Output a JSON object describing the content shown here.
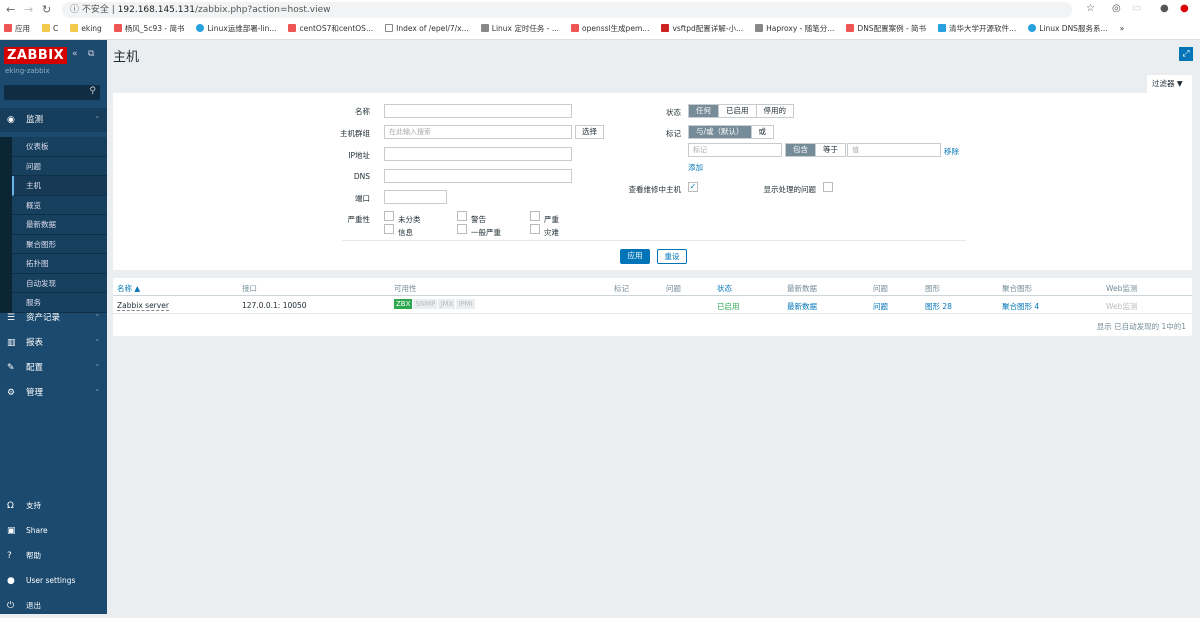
{
  "browser": {
    "security": "不安全",
    "url_host": "192.168.145.131",
    "url_path": "/zabbix.php?action=host.view",
    "bookmarks": [
      "应用",
      "C",
      "eking",
      "杨风_5c93 - 简书",
      "Linux运维部署-lin...",
      "centOS7和centOS...",
      "Index of /epel/7/x...",
      "Linux 定时任务 - ...",
      "openssl生成pem...",
      "vsftpd配置详解-小...",
      "Haproxy - 随笔分...",
      "DNS配置案例 - 简书",
      "清华大学开源软件...",
      "Linux DNS服务系..."
    ],
    "more": "»"
  },
  "sidebar": {
    "logo": "ZABBIX",
    "server": "eking-zabbix",
    "monitoring": "监测",
    "items": [
      "仪表板",
      "问题",
      "主机",
      "概览",
      "最新数据",
      "聚合图形",
      "拓扑图",
      "自动发现",
      "服务"
    ],
    "active": "主机",
    "groups": [
      "资产记录",
      "报表",
      "配置",
      "管理"
    ],
    "bottom": [
      "支持",
      "Share",
      "帮助",
      "User settings",
      "退出"
    ]
  },
  "page": {
    "title": "主机",
    "filter_tab": "过滤器"
  },
  "filter": {
    "name_label": "名称",
    "hostgroup_label": "主机群组",
    "hostgroup_placeholder": "在此输入搜索",
    "select": "选择",
    "ip_label": "IP地址",
    "dns_label": "DNS",
    "port_label": "端口",
    "severity_label": "严重性",
    "severities": [
      "未分类",
      "警告",
      "严重",
      "信息",
      "一般严重",
      "灾难"
    ],
    "status_label": "状态",
    "status_options": [
      "任何",
      "已启用",
      "停用的"
    ],
    "status_selected": "任何",
    "tags_label": "标记",
    "tag_ops": [
      "与/或（默认）",
      "或"
    ],
    "tag_placeholder": "标记",
    "tag_match": [
      "包含",
      "等于"
    ],
    "value_placeholder": "值",
    "remove": "移除",
    "add": "添加",
    "maintenance_label": "查看维修中主机",
    "maintenance_checked": true,
    "suppressed_label": "显示处理的问题",
    "suppressed_checked": false,
    "apply": "应用",
    "reset": "重设"
  },
  "table": {
    "headers": [
      "名称 ▲",
      "接口",
      "可用性",
      "标记",
      "问题",
      "状态",
      "最新数据",
      "问题",
      "图形",
      "聚合图形",
      "Web监测"
    ],
    "rows": [
      {
        "name": "Zabbix server",
        "interface": "127.0.0.1: 10050",
        "availability": [
          "ZBX",
          "SNMP",
          "JMX",
          "IPMI"
        ],
        "status": "已启用",
        "latest": "最新数据",
        "problems": "问题",
        "graphs": "图形 28",
        "screens": "聚合图形 4",
        "web": "Web监测"
      }
    ],
    "footer": "显示 已自动发现的 1中的1"
  },
  "colors": {
    "sidebar": "#1c4a6e",
    "accent": "#0275b8",
    "zbx_available": "#2da84f",
    "enabled": "#2da84f",
    "logo": "#d40000"
  }
}
